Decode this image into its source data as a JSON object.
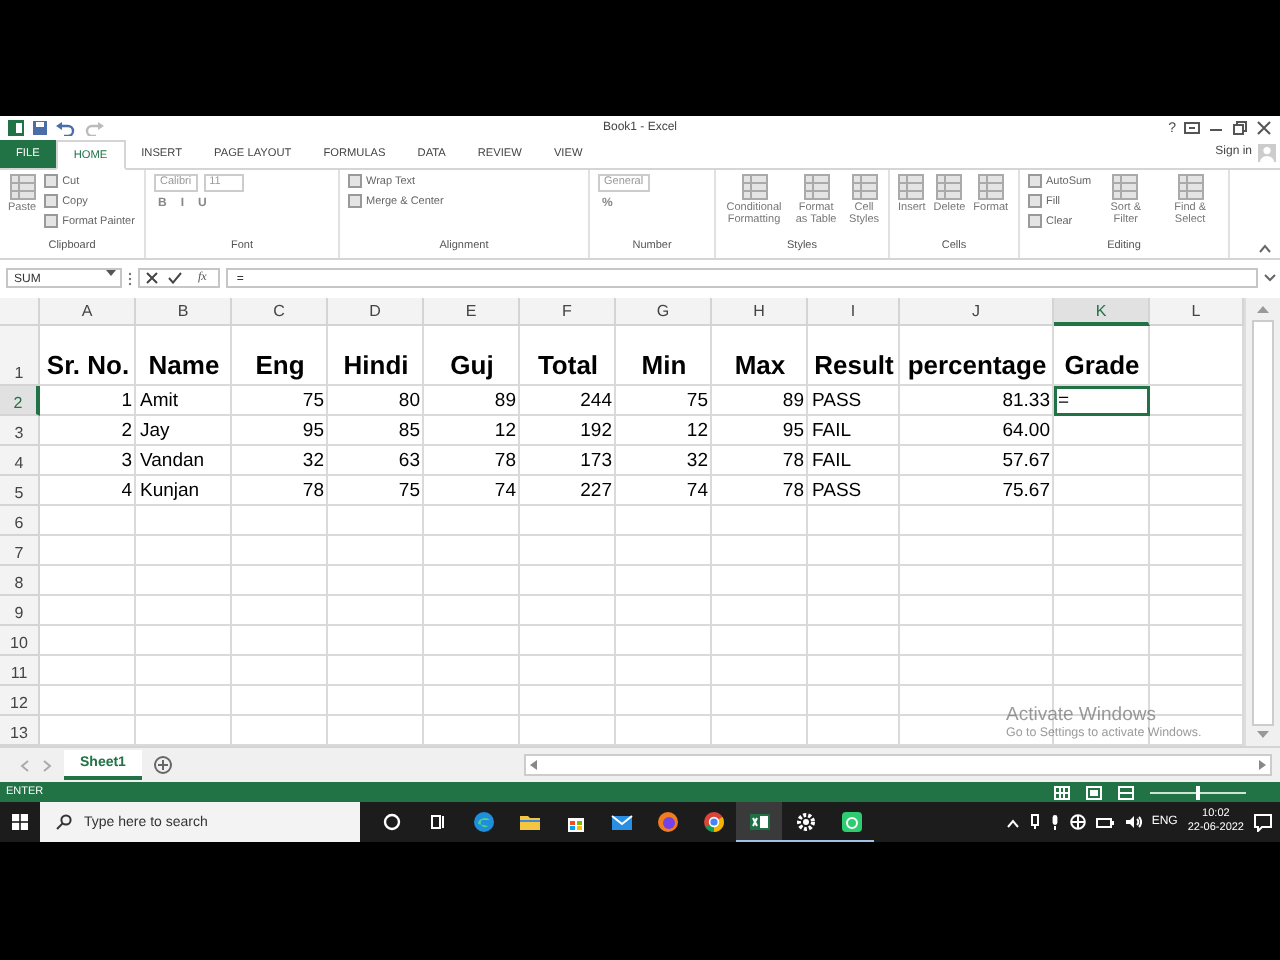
{
  "title_bar": {
    "title": "Book1 - Excel",
    "help": "?",
    "sign_in": "Sign in"
  },
  "ribbon_tabs": [
    {
      "label": "FILE",
      "kind": "file",
      "selected": false
    },
    {
      "label": "HOME",
      "kind": "tab",
      "selected": true
    },
    {
      "label": "INSERT",
      "kind": "tab",
      "selected": false
    },
    {
      "label": "PAGE LAYOUT",
      "kind": "tab",
      "selected": false
    },
    {
      "label": "FORMULAS",
      "kind": "tab",
      "selected": false
    },
    {
      "label": "DATA",
      "kind": "tab",
      "selected": false
    },
    {
      "label": "REVIEW",
      "kind": "tab",
      "selected": false
    },
    {
      "label": "VIEW",
      "kind": "tab",
      "selected": false
    }
  ],
  "ribbon_groups": [
    {
      "label": "Clipboard",
      "items": [
        {
          "kind": "large",
          "label": "Paste"
        },
        {
          "kind": "small",
          "label": "Cut"
        },
        {
          "kind": "small",
          "label": "Copy"
        },
        {
          "kind": "small",
          "label": "Format Painter"
        }
      ]
    },
    {
      "label": "Font",
      "items": [
        {
          "kind": "line",
          "parts": [
            {
              "kind": "field",
              "label": "Calibri"
            },
            {
              "kind": "field",
              "label": "11"
            }
          ]
        },
        {
          "kind": "line",
          "parts": [
            {
              "kind": "glyph",
              "label": "B"
            },
            {
              "kind": "glyph",
              "label": "I"
            },
            {
              "kind": "glyph",
              "label": "U"
            }
          ]
        }
      ]
    },
    {
      "label": "Alignment",
      "items": [
        {
          "kind": "small",
          "label": "Wrap Text"
        },
        {
          "kind": "small",
          "label": "Merge & Center"
        }
      ]
    },
    {
      "label": "Number",
      "items": [
        {
          "kind": "line",
          "parts": [
            {
              "kind": "field",
              "label": "General"
            }
          ]
        },
        {
          "kind": "line",
          "parts": [
            {
              "kind": "glyph",
              "label": "%"
            }
          ]
        }
      ]
    },
    {
      "label": "Styles",
      "items": [
        {
          "kind": "large",
          "label": "Conditional Formatting"
        },
        {
          "kind": "large",
          "label": "Format as Table"
        },
        {
          "kind": "large",
          "label": "Cell Styles"
        }
      ]
    },
    {
      "label": "Cells",
      "items": [
        {
          "kind": "large",
          "label": "Insert"
        },
        {
          "kind": "large",
          "label": "Delete"
        },
        {
          "kind": "large",
          "label": "Format"
        }
      ]
    },
    {
      "label": "Editing",
      "items": [
        {
          "kind": "small",
          "label": "AutoSum"
        },
        {
          "kind": "small",
          "label": "Fill"
        },
        {
          "kind": "small",
          "label": "Clear"
        },
        {
          "kind": "large",
          "label": "Sort & Filter"
        },
        {
          "kind": "large",
          "label": "Find & Select"
        }
      ]
    }
  ],
  "formula_bar": {
    "name_box": "SUM",
    "function_label": "fx",
    "value": "="
  },
  "sheet": {
    "columns": [
      {
        "label": "A",
        "selected": false
      },
      {
        "label": "B",
        "selected": false
      },
      {
        "label": "C",
        "selected": false
      },
      {
        "label": "D",
        "selected": false
      },
      {
        "label": "E",
        "selected": false
      },
      {
        "label": "F",
        "selected": false
      },
      {
        "label": "G",
        "selected": false
      },
      {
        "label": "H",
        "selected": false
      },
      {
        "label": "I",
        "selected": false
      },
      {
        "label": "J",
        "selected": false
      },
      {
        "label": "K",
        "selected": true
      },
      {
        "label": "L",
        "selected": false
      }
    ],
    "rows": [
      {
        "label": "1",
        "selected": false,
        "cells": [
          {
            "text": "Sr. No.",
            "selected": false
          },
          {
            "text": "Name",
            "selected": false
          },
          {
            "text": "Eng",
            "selected": false
          },
          {
            "text": "Hindi",
            "selected": false
          },
          {
            "text": "Guj",
            "selected": false
          },
          {
            "text": "Total",
            "selected": false
          },
          {
            "text": "Min",
            "selected": false
          },
          {
            "text": "Max",
            "selected": false
          },
          {
            "text": "Result",
            "selected": false
          },
          {
            "text": "percentage",
            "selected": false
          },
          {
            "text": "Grade",
            "selected": false
          }
        ]
      },
      {
        "label": "2",
        "selected": true,
        "cells": [
          {
            "text": "1",
            "selected": false
          },
          {
            "text": "Amit",
            "selected": false
          },
          {
            "text": "75",
            "selected": false
          },
          {
            "text": "80",
            "selected": false
          },
          {
            "text": "89",
            "selected": false
          },
          {
            "text": "244",
            "selected": false
          },
          {
            "text": "75",
            "selected": false
          },
          {
            "text": "89",
            "selected": false
          },
          {
            "text": "PASS",
            "selected": false
          },
          {
            "text": "81.33",
            "selected": false
          },
          {
            "text": "=",
            "selected": true
          }
        ]
      },
      {
        "label": "3",
        "selected": false,
        "cells": [
          {
            "text": "2",
            "selected": false
          },
          {
            "text": "Jay",
            "selected": false
          },
          {
            "text": "95",
            "selected": false
          },
          {
            "text": "85",
            "selected": false
          },
          {
            "text": "12",
            "selected": false
          },
          {
            "text": "192",
            "selected": false
          },
          {
            "text": "12",
            "selected": false
          },
          {
            "text": "95",
            "selected": false
          },
          {
            "text": "FAIL",
            "selected": false
          },
          {
            "text": "64.00",
            "selected": false
          }
        ]
      },
      {
        "label": "4",
        "selected": false,
        "cells": [
          {
            "text": "3",
            "selected": false
          },
          {
            "text": "Vandan",
            "selected": false
          },
          {
            "text": "32",
            "selected": false
          },
          {
            "text": "63",
            "selected": false
          },
          {
            "text": "78",
            "selected": false
          },
          {
            "text": "173",
            "selected": false
          },
          {
            "text": "32",
            "selected": false
          },
          {
            "text": "78",
            "selected": false
          },
          {
            "text": "FAIL",
            "selected": false
          },
          {
            "text": "57.67",
            "selected": false
          }
        ]
      },
      {
        "label": "5",
        "selected": false,
        "cells": [
          {
            "text": "4",
            "selected": false
          },
          {
            "text": "Kunjan",
            "selected": false
          },
          {
            "text": "78",
            "selected": false
          },
          {
            "text": "75",
            "selected": false
          },
          {
            "text": "74",
            "selected": false
          },
          {
            "text": "227",
            "selected": false
          },
          {
            "text": "74",
            "selected": false
          },
          {
            "text": "78",
            "selected": false
          },
          {
            "text": "PASS",
            "selected": false
          },
          {
            "text": "75.67",
            "selected": false
          }
        ]
      },
      {
        "label": "6",
        "selected": false
      },
      {
        "label": "7",
        "selected": false
      },
      {
        "label": "8",
        "selected": false
      },
      {
        "label": "9",
        "selected": false
      },
      {
        "label": "10",
        "selected": false
      },
      {
        "label": "11",
        "selected": false
      },
      {
        "label": "12",
        "selected": false
      },
      {
        "label": "13",
        "selected": false
      }
    ]
  },
  "sheet_tabs": [
    {
      "label": "Sheet1",
      "selected": true
    }
  ],
  "activation_notice": {
    "title": "Activate Windows",
    "text": "Go to Settings to activate Windows."
  },
  "status_bar": {
    "mode": "ENTER",
    "zoom": {
      "level": 0.5
    }
  },
  "taskbar": {
    "search": {
      "placeholder": "Type here to search"
    },
    "apps": [
      {
        "kind": "cortana",
        "running": false,
        "active": false
      },
      {
        "kind": "task-view",
        "running": false,
        "active": false
      },
      {
        "kind": "edge",
        "running": false,
        "active": false
      },
      {
        "kind": "files",
        "running": false,
        "active": false
      },
      {
        "kind": "store",
        "running": false,
        "active": false
      },
      {
        "kind": "mail",
        "running": false,
        "active": false
      },
      {
        "kind": "firefox",
        "running": false,
        "active": false
      },
      {
        "kind": "chrome",
        "running": false,
        "active": false
      },
      {
        "kind": "excel",
        "running": true,
        "active": true
      },
      {
        "kind": "settings",
        "running": true,
        "active": false
      },
      {
        "kind": "green-app",
        "running": true,
        "active": false
      }
    ],
    "language": "ENG",
    "time": "10:02",
    "date": "22-06-2022"
  }
}
